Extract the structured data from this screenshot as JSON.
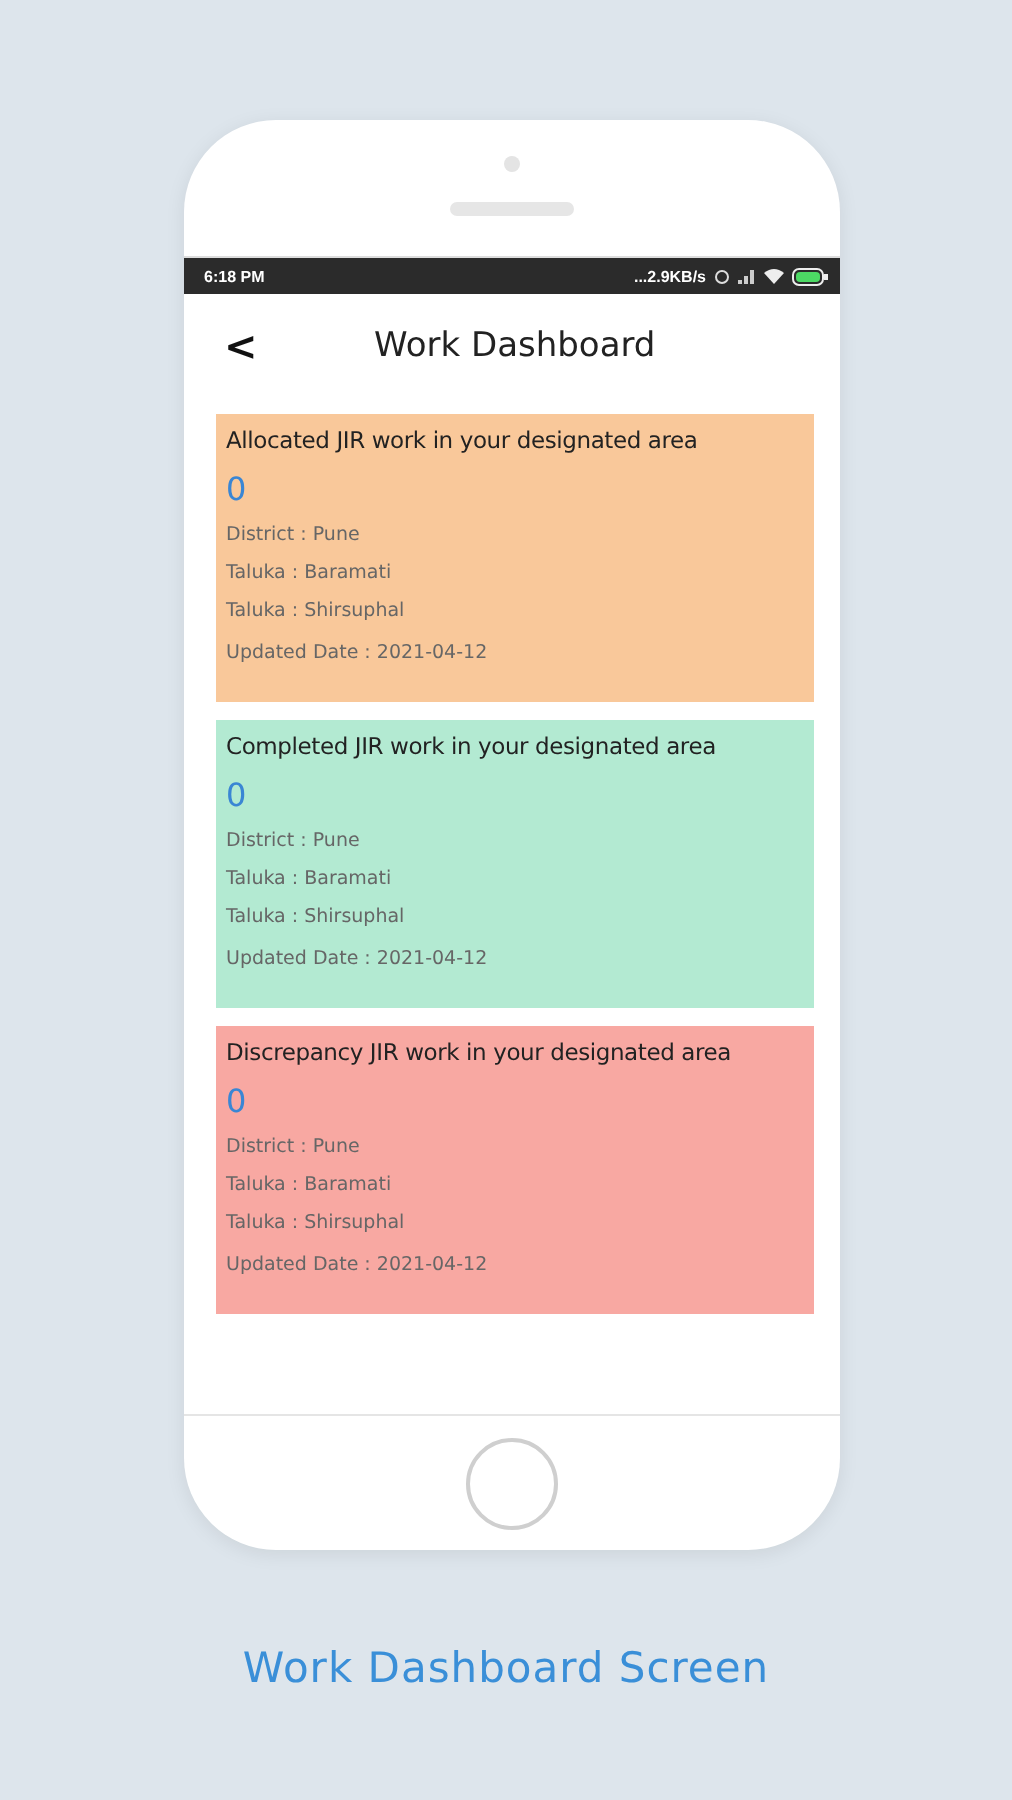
{
  "status_bar": {
    "time": "6:18 PM",
    "network_speed": "...2.9KB/s"
  },
  "header": {
    "back": "<",
    "title": "Work Dashboard"
  },
  "cards": [
    {
      "title": "Allocated JIR work in your designated area",
      "count": "0",
      "color": "#f9c89a",
      "details": [
        "District : Pune",
        "Taluka : Baramati",
        "Taluka : Shirsuphal"
      ],
      "updated": "Updated Date : 2021-04-12"
    },
    {
      "title": "Completed JIR work in your designated area",
      "count": "0",
      "color": "#b3ead2",
      "details": [
        "District : Pune",
        "Taluka : Baramati",
        "Taluka : Shirsuphal"
      ],
      "updated": "Updated Date : 2021-04-12"
    },
    {
      "title": "Discrepancy JIR work in your designated area",
      "count": "0",
      "color": "#f8a8a2",
      "details": [
        "District : Pune",
        "Taluka : Baramati",
        "Taluka : Shirsuphal"
      ],
      "updated": "Updated Date : 2021-04-12"
    }
  ],
  "caption": "Work Dashboard Screen"
}
